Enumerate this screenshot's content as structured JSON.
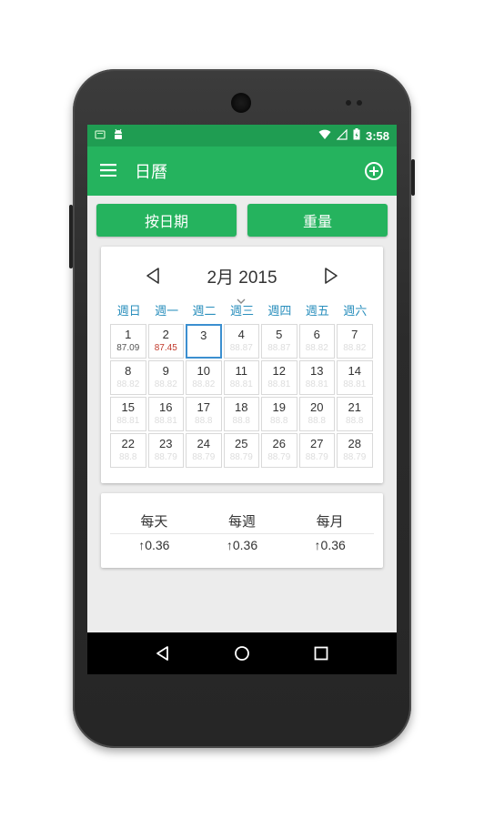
{
  "status": {
    "time": "3:58",
    "left_icons": [
      "notification-icon",
      "android-icon"
    ],
    "right_icons": [
      "wifi-icon",
      "signal-icon",
      "battery-icon"
    ]
  },
  "appbar": {
    "title": "日曆",
    "menu_icon": "menu-icon",
    "add_icon": "add-circle-icon"
  },
  "buttons": {
    "by_date": "按日期",
    "weight": "重量"
  },
  "calendar": {
    "month_label": "2月 2015",
    "weekdays": [
      "週日",
      "週一",
      "週二",
      "週三",
      "週四",
      "週五",
      "週六"
    ],
    "selected_day": "3",
    "days": [
      {
        "d": "1",
        "w": "87.09",
        "s": "past"
      },
      {
        "d": "2",
        "w": "87.45",
        "s": "today"
      },
      {
        "d": "3",
        "w": "",
        "s": "selected"
      },
      {
        "d": "4",
        "w": "88.87",
        "s": "future"
      },
      {
        "d": "5",
        "w": "88.87",
        "s": "future"
      },
      {
        "d": "6",
        "w": "88.82",
        "s": "future"
      },
      {
        "d": "7",
        "w": "88.82",
        "s": "future"
      },
      {
        "d": "8",
        "w": "88.82",
        "s": "future"
      },
      {
        "d": "9",
        "w": "88.82",
        "s": "future"
      },
      {
        "d": "10",
        "w": "88.82",
        "s": "future"
      },
      {
        "d": "11",
        "w": "88.81",
        "s": "future"
      },
      {
        "d": "12",
        "w": "88.81",
        "s": "future"
      },
      {
        "d": "13",
        "w": "88.81",
        "s": "future"
      },
      {
        "d": "14",
        "w": "88.81",
        "s": "future"
      },
      {
        "d": "15",
        "w": "88.81",
        "s": "future"
      },
      {
        "d": "16",
        "w": "88.81",
        "s": "future"
      },
      {
        "d": "17",
        "w": "88.8",
        "s": "future"
      },
      {
        "d": "18",
        "w": "88.8",
        "s": "future"
      },
      {
        "d": "19",
        "w": "88.8",
        "s": "future"
      },
      {
        "d": "20",
        "w": "88.8",
        "s": "future"
      },
      {
        "d": "21",
        "w": "88.8",
        "s": "future"
      },
      {
        "d": "22",
        "w": "88.8",
        "s": "future"
      },
      {
        "d": "23",
        "w": "88.79",
        "s": "future"
      },
      {
        "d": "24",
        "w": "88.79",
        "s": "future"
      },
      {
        "d": "25",
        "w": "88.79",
        "s": "future"
      },
      {
        "d": "26",
        "w": "88.79",
        "s": "future"
      },
      {
        "d": "27",
        "w": "88.79",
        "s": "future"
      },
      {
        "d": "28",
        "w": "88.79",
        "s": "future"
      }
    ]
  },
  "stats": {
    "headers": [
      "每天",
      "每週",
      "每月"
    ],
    "values": [
      "0.36",
      "0.36",
      "0.36"
    ],
    "arrow": "↑"
  },
  "colors": {
    "primary": "#25b35e",
    "status": "#1f9d52",
    "accent": "#2a8fbd",
    "today": "#c0392b"
  },
  "navbar_icons": [
    "back-icon",
    "home-icon",
    "recents-icon"
  ]
}
